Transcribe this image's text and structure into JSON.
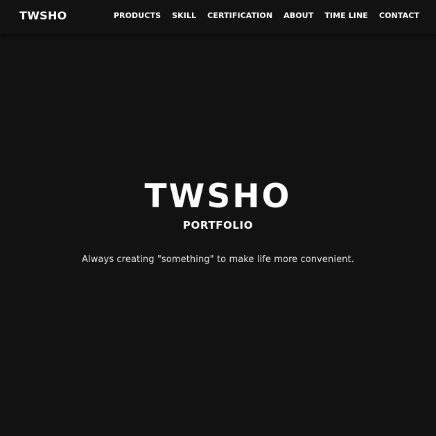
{
  "header": {
    "brand": "TWSHO",
    "nav": [
      {
        "label": "PRODUCTS"
      },
      {
        "label": "SKILL"
      },
      {
        "label": "CERTIFICATION"
      },
      {
        "label": "ABOUT"
      },
      {
        "label": "TIME LINE"
      },
      {
        "label": "CONTACT"
      }
    ]
  },
  "hero": {
    "title": "TWSHO",
    "subtitle": "PORTFOLIO",
    "tagline": "Always creating \"something\" to make life more convenient."
  },
  "colors": {
    "background": "#121212",
    "text": "#ffffff"
  }
}
